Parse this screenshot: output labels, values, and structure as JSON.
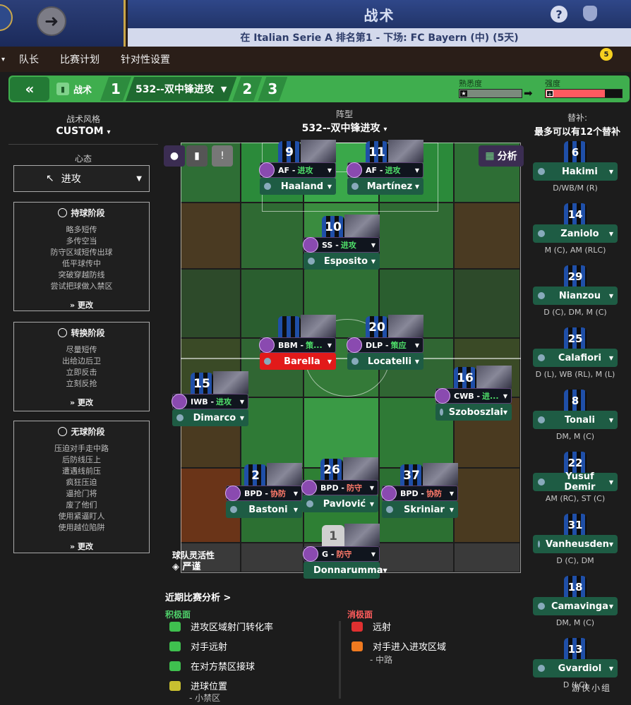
{
  "header": {
    "title": "战术",
    "subtitle": "在 Italian Serie A 排名第1 - 下场: FC Bayern (中) (5天)",
    "notif_count": "5"
  },
  "menu": [
    "队长",
    "比赛计划",
    "针对性设置"
  ],
  "tactic_bar": {
    "label": "战术",
    "slot1": "1",
    "tactic_name": "532--双中锋进攻",
    "slot2": "2",
    "slot3": "3",
    "familiarity_label": "熟悉度",
    "intensity_label": "强度",
    "intensity_level": 0.78,
    "familiarity_level": 0.9
  },
  "left_panel": {
    "style_label": "战术风格",
    "style_value": "CUSTOM",
    "mentality_label": "心态",
    "mentality_value": "进攻",
    "phases": [
      {
        "title": "持球阶段",
        "lines": [
          "略多短传",
          "多传空当",
          "防守区域短传出球",
          "低平球传中",
          "突破穿越防线",
          "尝试把球做入禁区"
        ],
        "edit": "更改"
      },
      {
        "title": "转换阶段",
        "lines": [
          "尽量短传",
          "出给边后卫",
          "立即反击",
          "立刻反抢"
        ],
        "edit": "更改"
      },
      {
        "title": "无球阶段",
        "lines": [
          "压迫对手走中路",
          "后防线压上",
          "遭遇线前压",
          "疯狂压迫",
          "逼抢门将",
          "废了他们",
          "使用紧逼盯人",
          "使用越位陷阱"
        ],
        "edit": "更改"
      }
    ]
  },
  "pitch": {
    "formation_label": "阵型",
    "formation_value": "532--双中锋进攻",
    "analysis_btn": "分析",
    "flex_label": "球队灵活性",
    "flex_value": "严谨",
    "players": [
      {
        "num": "9",
        "role": "AF",
        "duty": "进攻",
        "duty_type": "att",
        "name": "Haaland"
      },
      {
        "num": "11",
        "role": "AF",
        "duty": "进攻",
        "duty_type": "att",
        "name": "Martínez"
      },
      {
        "num": "10",
        "role": "SS",
        "duty": "进攻",
        "duty_type": "att",
        "name": "Esposito"
      },
      {
        "num": "",
        "role": "BBM",
        "duty": "策...",
        "duty_type": "sup",
        "name": "Barella"
      },
      {
        "num": "20",
        "role": "DLP",
        "duty": "策应",
        "duty_type": "sup",
        "name": "Locatelli"
      },
      {
        "num": "15",
        "role": "IWB",
        "duty": "进攻",
        "duty_type": "att",
        "name": "Dimarco"
      },
      {
        "num": "16",
        "role": "CWB",
        "duty": "进...",
        "duty_type": "att",
        "name": "Szoboszlai"
      },
      {
        "num": "2",
        "role": "BPD",
        "duty": "协防",
        "duty_type": "def",
        "name": "Bastoni"
      },
      {
        "num": "26",
        "role": "BPD",
        "duty": "防守",
        "duty_type": "def",
        "name": "Pavlović"
      },
      {
        "num": "37",
        "role": "BPD",
        "duty": "协防",
        "duty_type": "def",
        "name": "Skriniar"
      },
      {
        "num": "1",
        "role": "G",
        "duty": "防守",
        "duty_type": "def",
        "name": "Donnarumma"
      }
    ]
  },
  "subs": {
    "label": "替补:",
    "max": "最多可以有12个替补",
    "list": [
      {
        "num": "6",
        "name": "Hakimi",
        "pos": "D/WB/M (R)"
      },
      {
        "num": "14",
        "name": "Zaniolo",
        "pos": "M (C), AM (RLC)"
      },
      {
        "num": "29",
        "name": "Nianzou",
        "pos": "D (C), DM, M (C)"
      },
      {
        "num": "25",
        "name": "Calafiori",
        "pos": "D (L), WB (RL), M (L)"
      },
      {
        "num": "8",
        "name": "Tonali",
        "pos": "DM, M (C)"
      },
      {
        "num": "22",
        "name": "Yusuf Demir",
        "pos": "AM (RC), ST (C)"
      },
      {
        "num": "31",
        "name": "Vanheusden",
        "pos": "D (C), DM"
      },
      {
        "num": "18",
        "name": "Camavinga",
        "pos": "DM, M (C)"
      },
      {
        "num": "13",
        "name": "Gvardiol",
        "pos": "D (LC)"
      }
    ]
  },
  "analysis": {
    "title": "近期比赛分析 >",
    "positive_label": "积极面",
    "negative_label": "消极面",
    "positives": [
      "进攻区域射门转化率",
      "对手远射",
      "在对方禁区接球",
      "进球位置"
    ],
    "positive_sub": "- 小禁区",
    "negatives": [
      "远射",
      "对手进入进攻区域"
    ],
    "negative_sub": "- 中路"
  },
  "watermark": "游侠小组"
}
